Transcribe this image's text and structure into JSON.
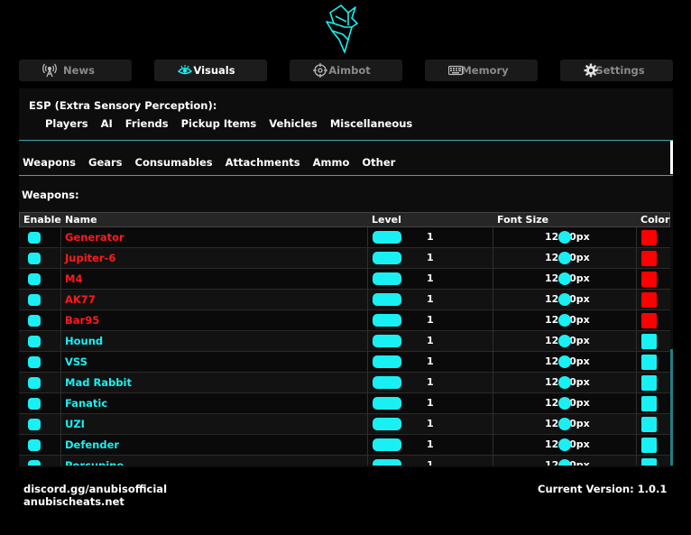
{
  "tabs": [
    {
      "label": "News",
      "icon": "antenna-icon",
      "active": false
    },
    {
      "label": "Visuals",
      "icon": "eye-icon",
      "active": true
    },
    {
      "label": "Aimbot",
      "icon": "crosshair-icon",
      "active": false
    },
    {
      "label": "Memory",
      "icon": "keyboard-icon",
      "active": false
    },
    {
      "label": "Settings",
      "icon": "gear-icon",
      "active": false
    }
  ],
  "esp": {
    "title": "ESP (Extra Sensory Perception):",
    "subtabs": [
      "Players",
      "AI",
      "Friends",
      "Pickup Items",
      "Vehicles",
      "Miscellaneous"
    ]
  },
  "categories": [
    "Weapons",
    "Gears",
    "Consumables",
    "Attachments",
    "Ammo",
    "Other"
  ],
  "section_title": "Weapons:",
  "table": {
    "headers": {
      "enable": "Enable",
      "name": "Name",
      "level": "Level",
      "font_size": "Font Size",
      "color": "Color"
    },
    "rows": [
      {
        "name": "Generator",
        "level": "1",
        "font_size": "12.00px",
        "color": "#ff0000"
      },
      {
        "name": "Jupiter-6",
        "level": "1",
        "font_size": "12.00px",
        "color": "#ff0000"
      },
      {
        "name": "M4",
        "level": "1",
        "font_size": "12.00px",
        "color": "#ff0000"
      },
      {
        "name": "AK77",
        "level": "1",
        "font_size": "12.00px",
        "color": "#ff0000"
      },
      {
        "name": "Bar95",
        "level": "1",
        "font_size": "12.00px",
        "color": "#ff0000"
      },
      {
        "name": "Hound",
        "level": "1",
        "font_size": "12.00px",
        "color": "#19f0f3"
      },
      {
        "name": "VSS",
        "level": "1",
        "font_size": "12.00px",
        "color": "#19f0f3"
      },
      {
        "name": "Mad Rabbit",
        "level": "1",
        "font_size": "12.00px",
        "color": "#19f0f3"
      },
      {
        "name": "Fanatic",
        "level": "1",
        "font_size": "12.00px",
        "color": "#19f0f3"
      },
      {
        "name": "UZI",
        "level": "1",
        "font_size": "12.00px",
        "color": "#19f0f3"
      },
      {
        "name": "Defender",
        "level": "1",
        "font_size": "12.00px",
        "color": "#19f0f3"
      },
      {
        "name": "Porcupine",
        "level": "1",
        "font_size": "12.00px",
        "color": "#19f0f3"
      }
    ]
  },
  "footer": {
    "discord": "discord.gg/anubisofficial",
    "site": "anubischeats.net",
    "version": "Current Version: 1.0.1"
  },
  "colors": {
    "accent": "#19f0f3",
    "danger": "#ff0000"
  }
}
